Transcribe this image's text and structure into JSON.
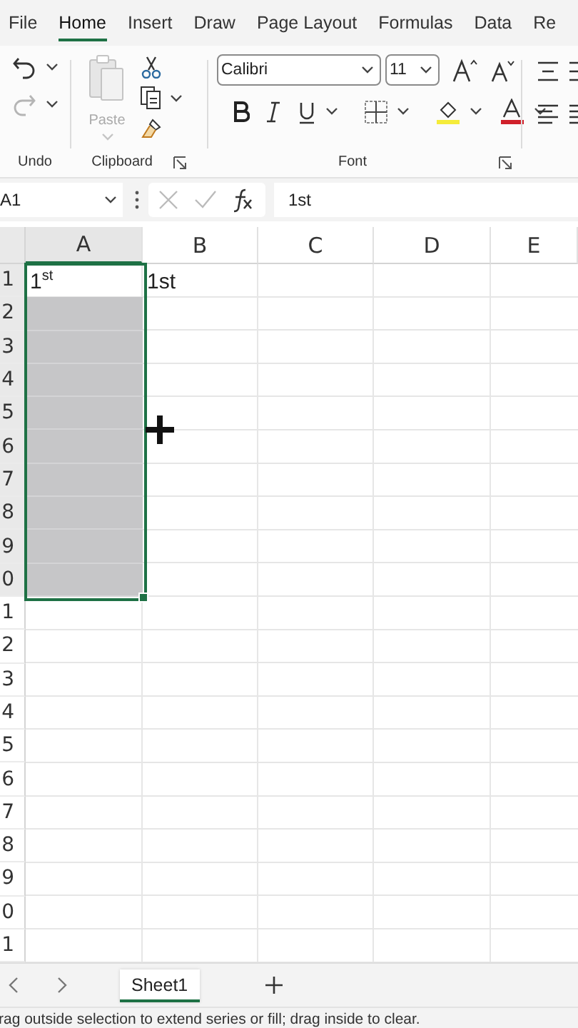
{
  "ribbon_tabs": [
    {
      "label": "File",
      "selected": false
    },
    {
      "label": "Home",
      "selected": true
    },
    {
      "label": "Insert",
      "selected": false
    },
    {
      "label": "Draw",
      "selected": false
    },
    {
      "label": "Page Layout",
      "selected": false
    },
    {
      "label": "Formulas",
      "selected": false
    },
    {
      "label": "Data",
      "selected": false
    },
    {
      "label": "Re",
      "selected": false
    }
  ],
  "undo_group": {
    "label": "Undo",
    "buttons": [
      {
        "kind": "undo",
        "disabled": false
      },
      {
        "kind": "redo",
        "disabled": true
      }
    ]
  },
  "clipboard_group": {
    "label": "Clipboard",
    "paste": {
      "label": "Paste",
      "disabled": true
    }
  },
  "font_group": {
    "label": "Font",
    "font_name": "Calibri",
    "font_size": "11"
  },
  "name_box": "A1",
  "formula": "1st",
  "columns": [
    {
      "label": "A",
      "selected": true
    },
    {
      "label": "B",
      "selected": false
    },
    {
      "label": "C",
      "selected": false
    },
    {
      "label": "D",
      "selected": false
    },
    {
      "label": "E",
      "selected": false
    }
  ],
  "rows": [
    {
      "label": "1",
      "selected": true,
      "cells": [
        {
          "text": "1$^{st}$",
          "active": true
        },
        {
          "text": "1st",
          "active": false
        }
      ]
    },
    {
      "label": "2",
      "selected": true
    },
    {
      "label": "3",
      "selected": true
    },
    {
      "label": "4",
      "selected": true
    },
    {
      "label": "5",
      "selected": true
    },
    {
      "label": "6",
      "selected": true
    },
    {
      "label": "7",
      "selected": true
    },
    {
      "label": "8",
      "selected": true
    },
    {
      "label": "9",
      "selected": true
    },
    {
      "label": "0",
      "selected": true
    },
    {
      "label": "1",
      "selected": false
    },
    {
      "label": "2",
      "selected": false
    },
    {
      "label": "3",
      "selected": false
    },
    {
      "label": "4",
      "selected": false
    },
    {
      "label": "5",
      "selected": false
    },
    {
      "label": "6",
      "selected": false
    },
    {
      "label": "7",
      "selected": false
    },
    {
      "label": "8",
      "selected": false
    },
    {
      "label": "9",
      "selected": false
    },
    {
      "label": "0",
      "selected": false
    },
    {
      "label": "1",
      "selected": false
    }
  ],
  "sheet_tabs": [
    {
      "label": "Sheet1",
      "selected": true
    }
  ],
  "status_bar": "rag outside selection to extend series or fill; drag inside to clear."
}
